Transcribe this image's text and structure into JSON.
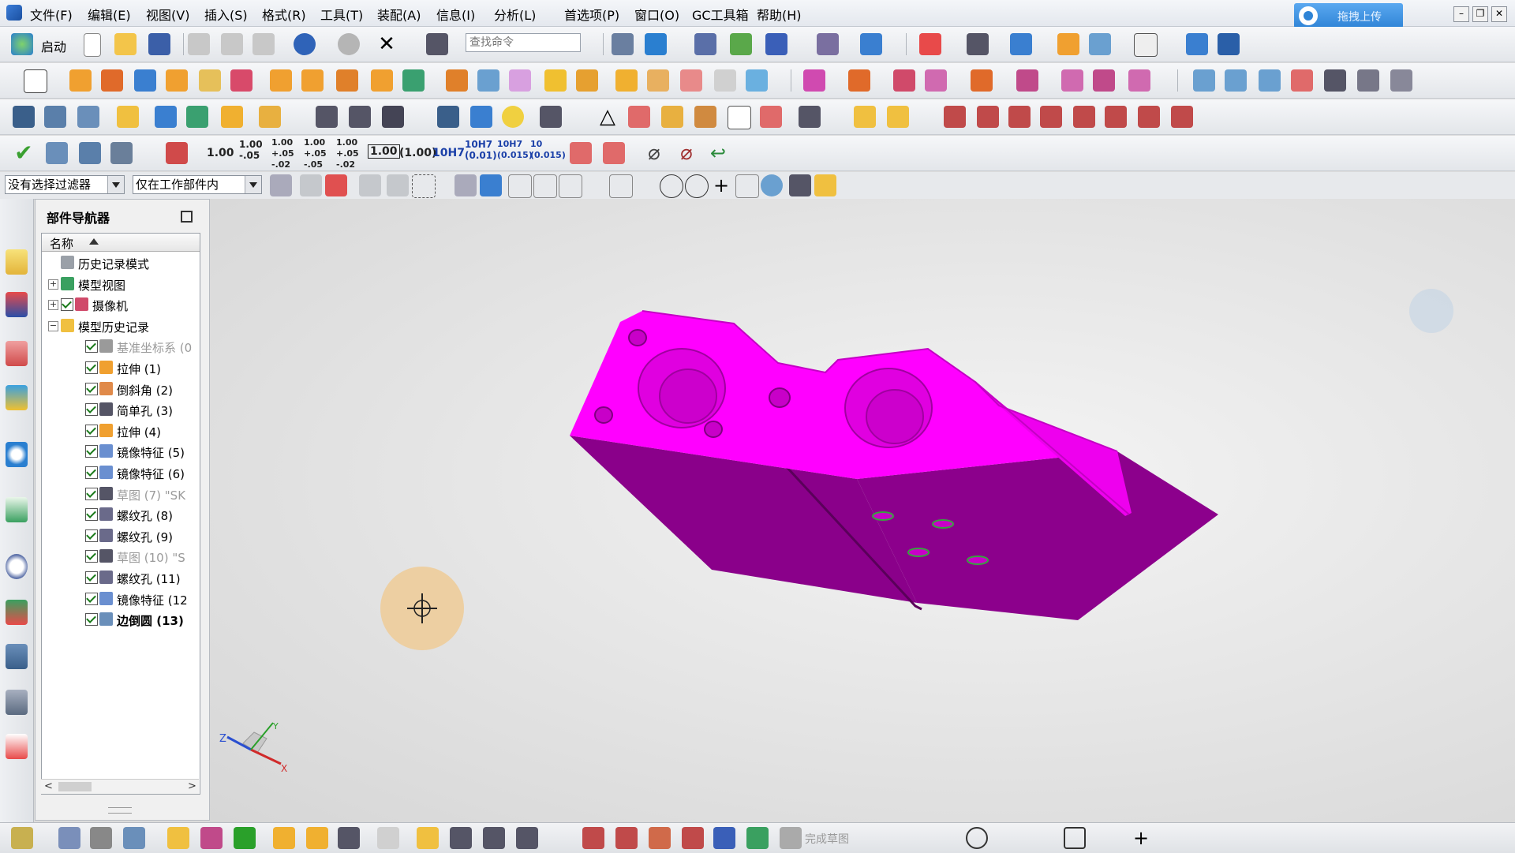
{
  "menu": {
    "items": [
      "文件(F)",
      "编辑(E)",
      "视图(V)",
      "插入(S)",
      "格式(R)",
      "工具(T)",
      "装配(A)",
      "信息(I)",
      "分析(L)",
      "首选项(P)",
      "窗口(O)",
      "GC工具箱",
      "帮助(H)"
    ],
    "upload_label": "拖拽上传"
  },
  "toolbar1": {
    "start_label": "启动",
    "search_placeholder": "查找命令"
  },
  "toolbar4": {
    "dimension_labels": [
      "1.00",
      "1.00\n-.05",
      "1.00\n+.05\n-.02",
      "1.00\n+.05\n-.05",
      "1.00\n+.05\n-.02",
      "1.00",
      "(1.00)",
      "10H7",
      "10H7\n(0.01)",
      "10H7\n(0.015)",
      "10\n(0.015)"
    ]
  },
  "selection_bar": {
    "filter": "没有选择过滤器",
    "scope": "仅在工作部件内"
  },
  "navigator": {
    "title": "部件导航器",
    "column_header": "名称",
    "tree": [
      {
        "label": "历史记录模式",
        "level": 0,
        "expander": "",
        "checked": false,
        "icon": "clock-icon",
        "dim": false,
        "bold": false
      },
      {
        "label": "模型视图",
        "level": 0,
        "expander": "+",
        "checked": false,
        "icon": "model-views-icon",
        "dim": false,
        "bold": false
      },
      {
        "label": "摄像机",
        "level": 0,
        "expander": "+",
        "checked": true,
        "icon": "camera-icon",
        "dim": false,
        "bold": false
      },
      {
        "label": "模型历史记录",
        "level": 0,
        "expander": "-",
        "checked": false,
        "icon": "folder-icon",
        "dim": false,
        "bold": false
      },
      {
        "label": "基准坐标系 (0",
        "level": 1,
        "expander": "",
        "checked": true,
        "icon": "datum-csys-icon",
        "dim": true,
        "bold": false
      },
      {
        "label": "拉伸 (1)",
        "level": 1,
        "expander": "",
        "checked": true,
        "icon": "extrude-icon",
        "dim": false,
        "bold": false
      },
      {
        "label": "倒斜角 (2)",
        "level": 1,
        "expander": "",
        "checked": true,
        "icon": "chamfer-icon",
        "dim": false,
        "bold": false
      },
      {
        "label": "简单孔 (3)",
        "level": 1,
        "expander": "",
        "checked": true,
        "icon": "simple-hole-icon",
        "dim": false,
        "bold": false
      },
      {
        "label": "拉伸 (4)",
        "level": 1,
        "expander": "",
        "checked": true,
        "icon": "extrude-icon",
        "dim": false,
        "bold": false
      },
      {
        "label": "镜像特征 (5)",
        "level": 1,
        "expander": "",
        "checked": true,
        "icon": "mirror-feature-icon",
        "dim": false,
        "bold": false
      },
      {
        "label": "镜像特征 (6)",
        "level": 1,
        "expander": "",
        "checked": true,
        "icon": "mirror-feature-icon",
        "dim": false,
        "bold": false
      },
      {
        "label": "草图 (7) \"SK",
        "level": 1,
        "expander": "",
        "checked": true,
        "icon": "sketch-icon",
        "dim": true,
        "bold": false
      },
      {
        "label": "螺纹孔 (8)",
        "level": 1,
        "expander": "",
        "checked": true,
        "icon": "threaded-hole-icon",
        "dim": false,
        "bold": false
      },
      {
        "label": "螺纹孔 (9)",
        "level": 1,
        "expander": "",
        "checked": true,
        "icon": "threaded-hole-icon",
        "dim": false,
        "bold": false
      },
      {
        "label": "草图 (10) \"S",
        "level": 1,
        "expander": "",
        "checked": true,
        "icon": "sketch-icon",
        "dim": true,
        "bold": false
      },
      {
        "label": "螺纹孔 (11)",
        "level": 1,
        "expander": "",
        "checked": true,
        "icon": "threaded-hole-icon",
        "dim": false,
        "bold": false
      },
      {
        "label": "镜像特征 (12",
        "level": 1,
        "expander": "",
        "checked": true,
        "icon": "mirror-feature-icon",
        "dim": false,
        "bold": false
      },
      {
        "label": "边倒圆 (13)",
        "level": 1,
        "expander": "",
        "checked": true,
        "icon": "edge-blend-icon",
        "dim": false,
        "bold": true
      }
    ]
  },
  "viewport": {
    "model_color": "#ff00ff",
    "model_shadow_color": "#8a008a",
    "triad_labels": {
      "x": "X",
      "y": "Y",
      "z": "Z"
    }
  },
  "bottombar": {
    "finish_sketch_label": "完成草图"
  },
  "colors": {
    "accent": "#2f84d6",
    "tree_check": "#1a7a1a"
  }
}
